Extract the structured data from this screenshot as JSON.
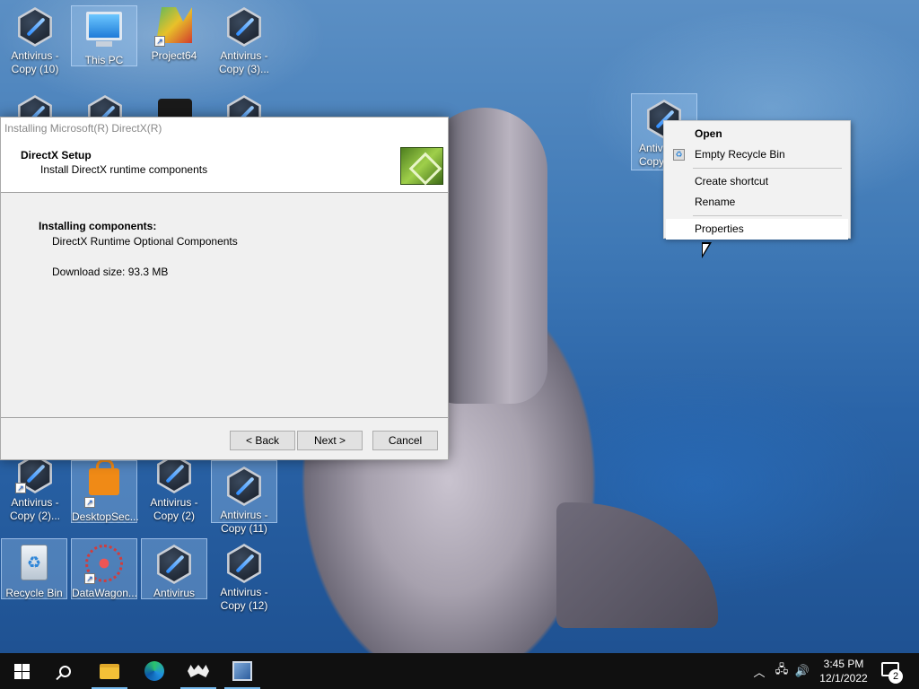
{
  "desktop": {
    "icons": [
      {
        "label": "Antivirus -\nCopy (10)"
      },
      {
        "label": "This PC"
      },
      {
        "label": "Project64"
      },
      {
        "label": "Antivirus -\nCopy (3)..."
      },
      {
        "label": "Antivirus -\nCopy (2)..."
      },
      {
        "label": "DesktopSec..."
      },
      {
        "label": "Antivirus -\nCopy (2)"
      },
      {
        "label": "Antivirus -\nCopy (11)"
      },
      {
        "label": "Recycle Bin"
      },
      {
        "label": "DataWagon..."
      },
      {
        "label": "Antivirus"
      },
      {
        "label": "Antivirus -\nCopy (12)"
      },
      {
        "label": "Antiv\nCopy"
      }
    ]
  },
  "installer": {
    "window_title": "Installing Microsoft(R) DirectX(R)",
    "header_title": "DirectX Setup",
    "header_subtitle": "Install DirectX runtime components",
    "body_heading": "Installing components:",
    "component_name": "DirectX Runtime Optional Components",
    "download_size": "Download size: 93.3 MB",
    "buttons": {
      "back": "< Back",
      "next": "Next >",
      "cancel": "Cancel"
    }
  },
  "context_menu": {
    "items": [
      {
        "label": "Open"
      },
      {
        "label": "Empty Recycle Bin"
      },
      {
        "label": "Create shortcut"
      },
      {
        "label": "Rename"
      },
      {
        "label": "Properties"
      }
    ]
  },
  "taskbar": {
    "time": "3:45 PM",
    "date": "12/1/2022",
    "notification_count": "2",
    "icons": [
      "windows-start-icon",
      "search-icon",
      "file-explorer-icon",
      "edge-icon",
      "alien-app-icon",
      "network-pc-icon"
    ]
  }
}
